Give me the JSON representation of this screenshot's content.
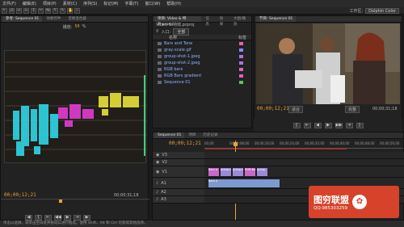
{
  "menu": [
    "文件(F)",
    "编辑(E)",
    "项目(P)",
    "素材(C)",
    "序列(S)",
    "标记(M)",
    "字幕(T)",
    "窗口(W)",
    "帮助(H)"
  ],
  "toolbar_icons": [
    "select-tool-icon",
    "track-select-icon",
    "ripple-icon",
    "rolling-icon",
    "rate-stretch-icon",
    "razor-icon",
    "slip-icon",
    "slide-icon",
    "pen-icon",
    "hand-icon",
    "zoom-icon"
  ],
  "workspace": {
    "label": "工作区:",
    "value": "Dolphin Color"
  },
  "scope": {
    "tabs": [
      "参考: Sequence 01",
      "效果控件",
      "音频混合器"
    ],
    "header_label": "播放:",
    "header_value": "50",
    "header_unit": "%",
    "timecode_left": "00;00;12;21",
    "timecode_right": "00;00;31;18"
  },
  "project": {
    "tabs": [
      "项目: Video & 特效.prproj",
      "信息",
      "效果",
      "大图/播放"
    ],
    "sub": "Video & 特效.prproj",
    "search_label": "入口:",
    "search_value": "全部",
    "col_name": "名称",
    "col_label": "标签",
    "items": [
      {
        "name": "Bars and Tone",
        "color": "#e060c0"
      },
      {
        "name": "gray-scale.gif",
        "color": "#8a8aff"
      },
      {
        "name": "group-shot-1.jpeg",
        "color": "#b070e0"
      },
      {
        "name": "group-shot-2.jpeg",
        "color": "#b070e0"
      },
      {
        "name": "RGB bars",
        "color": "#e060c0"
      },
      {
        "name": "RGB Bars gradient",
        "color": "#e060c0"
      },
      {
        "name": "Sequence 01",
        "color": "#60c060"
      }
    ]
  },
  "program": {
    "tab": "节目: Sequence 01",
    "timecode_left": "00;00;12;21",
    "fit": "适合",
    "quality": "完整",
    "timecode_right": "00;00;31;18"
  },
  "timeline": {
    "tabs": [
      "Sequence 01",
      "项目",
      "历史记录"
    ],
    "timecode": "00;00;12;21",
    "ruler": [
      "00;00",
      "00;00;08;00",
      "00;00;16;00",
      "00;00;24;00",
      "00;00;32;00",
      "00;00;40;00",
      "00;00;48;00",
      "00;00;56;00"
    ],
    "video_tracks": [
      "V3",
      "V2",
      "V1"
    ],
    "audio_tracks": [
      "A1",
      "A2",
      "A3"
    ],
    "v1_clips": [
      "Bars a",
      "group-s",
      "group-s",
      "RGB Bars g",
      "group"
    ],
    "a1_clip": "Bars a"
  },
  "status": "单击以选择，或单击空白处并拖动以进行框选。使用 Shift、Alt 和 Ctrl 可获得其他选项。",
  "watermark": {
    "title": "图穷联盟",
    "qq": "QQ:985303259"
  }
}
